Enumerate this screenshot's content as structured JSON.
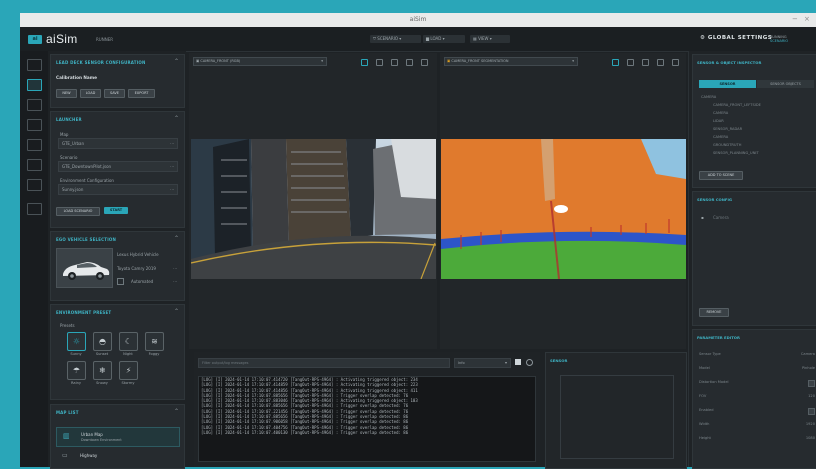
{
  "window": {
    "title": "aiSim"
  },
  "topbar": {
    "logo_badge": "ai",
    "logo": "aiSim",
    "logo_sub": "RUNNER",
    "buttons": [
      "SCENARIO",
      "LOAD",
      "VIEW"
    ],
    "global_settings": "GLOBAL SETTINGS",
    "user_line1": "RUNNING",
    "user_line2": "SCENARIO"
  },
  "side": {
    "calib": {
      "title": "LEAD DECK SENSOR CONFIGURATION",
      "subtitle": "Calibration Name",
      "buttons": [
        "NEW",
        "LOAD",
        "SAVE",
        "EXPORT"
      ]
    },
    "launcher": {
      "title": "LAUNCHER",
      "fields": [
        {
          "label": "Map",
          "value": "GTE_Urban"
        },
        {
          "label": "Scenario",
          "value": "GTE_DowntownPilot.json"
        },
        {
          "label": "Environment Configuration",
          "value": "Sunny.json"
        }
      ],
      "btn_secondary": "LOAD SCENARIO",
      "btn_primary": "START"
    },
    "vehicle": {
      "title": "EGO VEHICLE SELECTION",
      "name": "Lexus Hybrid Vehicle",
      "model": "Toyota Camry 2019",
      "option": "Automated"
    },
    "environment": {
      "title": "ENVIRONMENT PRESET",
      "subtitle": "Presets",
      "presets": [
        "Sunny",
        "Sunset",
        "Night",
        "Foggy",
        "Rainy",
        "Snowy",
        "Stormy"
      ]
    },
    "map_list": {
      "title": "MAP LIST",
      "items": [
        {
          "name": "Urban Map",
          "sub": "Downtown Environment"
        },
        {
          "name": "Highway",
          "sub": ""
        }
      ]
    }
  },
  "viewports": {
    "left_camera": "CAMERA_FRONT (RGB)",
    "right_camera": "CAMERA_FRONT SEGMENTATION"
  },
  "console": {
    "filter_placeholder": "Filter output/log messages",
    "level": "Info",
    "logs": [
      "[LOG] [I] 2024-01-14 17:10:07.414720 [TangOut-RPS-4964] : Activating triggered object: 234",
      "[LOG] [I] 2024-01-14 17:10:07.414859 [TangOut-RPS-4964] : Activating triggered object: 223",
      "[LOG] [I] 2024-01-14 17:10:07.414856 [TangOut-RPS-4964] : Activating triggered object: 411",
      "[LOG] [I] 2024-01-14 17:10:07.885656 [TangOut-RPS-4964] : Trigger overlap detected: 76",
      "[LOG] [I] 2024-01-14 17:10:07.883046 [TangOut-RPS-4964] : Activating triggered object: 103",
      "[LOG] [I] 2024-01-14 17:10:07.885656 [TangOut-RPS-4964] : Trigger overlap detected: 76",
      "[LOG] [I] 2024-01-14 17:10:07.221456 [TangOut-RPS-4964] : Trigger overlap detected: 76",
      "[LOG] [I] 2024-01-14 17:10:07.885656 [TangOut-RPS-4964] : Trigger overlap detected: 86",
      "[LOG] [I] 2024-01-14 17:10:07.906058 [TangOut-RPS-4964] : Trigger overlap detected: 86",
      "[LOG] [I] 2024-01-14 17:10:07.404756 [TangOut-RPS-4964] : Trigger overlap detected: 86",
      "[LOG] [I] 2024-01-14 17:10:07.400130 [TangOut-RPS-4964] : Trigger overlap detected: 86"
    ]
  },
  "sensor_panel": {
    "title": "SENSOR"
  },
  "right": {
    "sensors": {
      "title": "SENSOR & OBJECT INSPECTOR",
      "tabs": [
        "SENSOR",
        "SENSOR OBJECTS"
      ],
      "tree": [
        "CAMERA",
        "CAMERA_FRONT_LEFTSIDE",
        "CAMERA",
        "LIDAR",
        "SENSOR_RADAR",
        "CAMERA",
        "GROUNDTRUTH",
        "SENSOR_PLANNING_UNIT"
      ],
      "button": "ADD TO SCENE"
    },
    "sensor_config": {
      "title": "SENSOR CONFIG",
      "item": "Camera",
      "button": "REMOVE"
    },
    "params": {
      "title": "PARAMETER EDITOR",
      "rows": [
        {
          "k": "Sensor Type",
          "v": "Camera"
        },
        {
          "k": "Model",
          "v": "Pinhole"
        },
        {
          "k": "Distortion Model",
          "v": ""
        },
        {
          "k": "FOV",
          "v": "120"
        },
        {
          "k": "Enabled",
          "v": ""
        },
        {
          "k": "Width",
          "v": "1920"
        },
        {
          "k": "Height",
          "v": "1080"
        }
      ]
    }
  }
}
